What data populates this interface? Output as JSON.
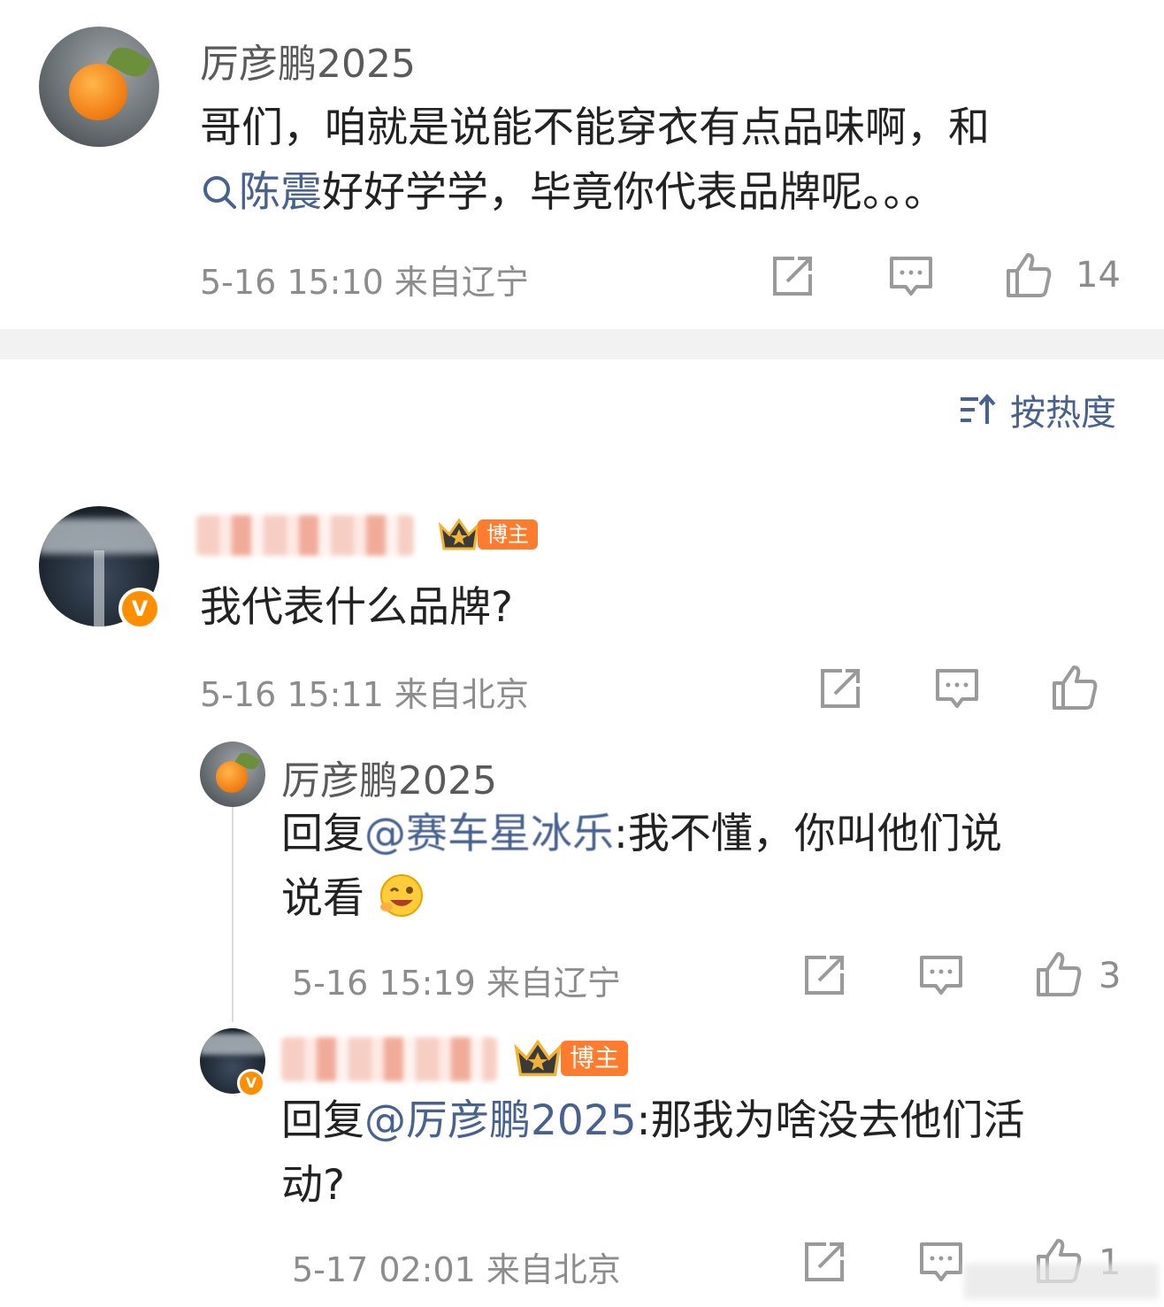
{
  "top_comment": {
    "author": "厉彦鹏2025",
    "text_line1": "哥们，咱就是说能不能穿衣有点品味啊，和",
    "mention": "陈震",
    "text_line2": "好好学学，毕竟你代表品牌呢。。。",
    "time": "5-16 15:10 来自辽宁",
    "likes": "14"
  },
  "sort": {
    "label": "按热度",
    "icon": "sort-icon"
  },
  "comment2": {
    "badge": "博主",
    "text": "我代表什么品牌?",
    "time": "5-16 15:11 来自北京",
    "verified": "V"
  },
  "reply1": {
    "author": "厉彦鹏2025",
    "prefix": "回复",
    "mention": "@赛车星冰乐",
    "text_line1": ":我不懂，你叫他们说",
    "text_line2": "说看",
    "emoji": "grin-wink-emoji",
    "time": "5-16 15:19 来自辽宁",
    "likes": "3"
  },
  "reply2": {
    "badge": "博主",
    "prefix": "回复",
    "mention": "@厉彦鹏2025",
    "text_line1": ":那我为啥没去他们活",
    "text_line2": "动?",
    "time": "5-17 02:01 来自北京",
    "likes": "1",
    "verified": "V"
  },
  "colors": {
    "link": "#48628f",
    "meta": "#8c8c8c",
    "badge": "#ff7b2e",
    "divider": "#f2f2f2"
  }
}
